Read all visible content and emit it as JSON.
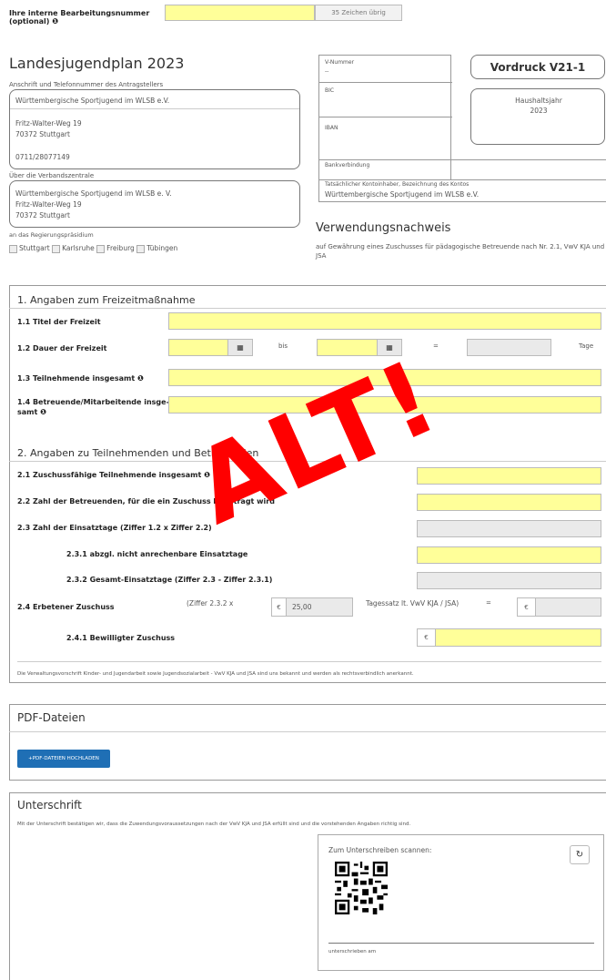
{
  "top": {
    "ref_label": "Ihre interne Bearbeitungsnummer",
    "ref_label_2": "(optional)",
    "ref_value": "",
    "chars_left": "35 Zeichen übrig"
  },
  "header": {
    "title": "Landesjugendplan 2023",
    "applicant_caption": "Anschrift und Telefonnummer des Antragstellers",
    "applicant_lines": [
      "Württembergische Sportjugend im WLSB e.V.",
      "Fritz-Walter-Weg 19",
      "70372 Stuttgart",
      "0711/28077149"
    ],
    "via_caption": "Über die Verbandszentrale",
    "via_lines": [
      "Württembergische Sportjugend im WLSB e. V.",
      "Fritz-Walter-Weg 19",
      "70372 Stuttgart"
    ],
    "rp_caption": "an das Regierungspräsidium",
    "rp_options": [
      "Stuttgart",
      "Karlsruhe",
      "Freiburg",
      "Tübingen"
    ],
    "v_nummer_label": "V-Nummer",
    "v_nummer_value": "--",
    "bic_label": "BIC",
    "iban_label": "IBAN",
    "bank_label": "Bankverbindung",
    "holder_label": "Tatsächlicher Kontoinhaber, Bezeichnung des Kontos",
    "holder_value": "Württembergische Sportjugend im WLSB e.V.",
    "form_code": "Vordruck V21-1",
    "year_label": "Haushaltsjahr",
    "year_value": "2023",
    "doc_title": "Verwendungsnachweis",
    "doc_subtitle": "auf Gewährung eines Zuschusses für pädagogische Betreuende nach Nr. 2.1, VwV KJA und JSA"
  },
  "section1": {
    "title": "1. Angaben zum Freizeitmaßnahme",
    "f11": "1.1 Titel der Freizeit",
    "f12": "1.2 Dauer der Freizeit",
    "bis": "bis",
    "equals": "=",
    "tage": "Tage",
    "f13": "1.3 Teilnehmende insgesamt",
    "f14a": "1.4 Betreuende/Mitarbeitende insge-",
    "f14b": "samt"
  },
  "section2": {
    "title": "2. Angaben zu Teilnehmenden und Betreuenden",
    "f21": "2.1 Zuschussfähige Teilnehmende insgesamt",
    "f22": "2.2 Zahl der Betreuenden, für die ein Zuschuss beantragt wird",
    "f23": "2.3 Zahl der Einsatztage (Ziffer 1.2 x Ziffer 2.2)",
    "f231": "2.3.1 abzgl. nicht anrechenbare Einsatztage",
    "f232": "2.3.2 Gesamt-Einsatztage (Ziffer 2.3 - Ziffer 2.3.1)",
    "f24": "2.4 Erbetener Zuschuss",
    "ziffer": "(Ziffer 2.3.2 x",
    "euro": "€",
    "rate": "25,00",
    "rate_label": "Tagessatz lt. VwV KJA / JSA)",
    "equals": "=",
    "f241": "2.4.1 Bewilligter Zuschuss",
    "footnote": "Die Verwaltungsvorschrift Kinder- und Jugendarbeit sowie Jugendsozialarbeit - VwV KJA und JSA sind uns bekannt und werden als rechtsverbindlich anerkannt."
  },
  "pdf": {
    "title": "PDF-Dateien",
    "upload": "PDF-DATEIEN HOCHLADEN"
  },
  "sign": {
    "title": "Unterschrift",
    "text": "Mit der Unterschrift bestätigen wir, dass die Zuwendungsvoraussetzungen nach der VwV KJA und JSA erfüllt sind und die vorstehenden Angaben richtig sind.",
    "scan": "Zum Unterschreiben scannen:",
    "refresh": "↻",
    "caption": "unterschrieben am"
  },
  "watermark": "ALT!",
  "colors": {
    "field_yellow": "#ffff99",
    "button_blue": "#1f6fb5",
    "watermark_red": "#ff0000"
  }
}
